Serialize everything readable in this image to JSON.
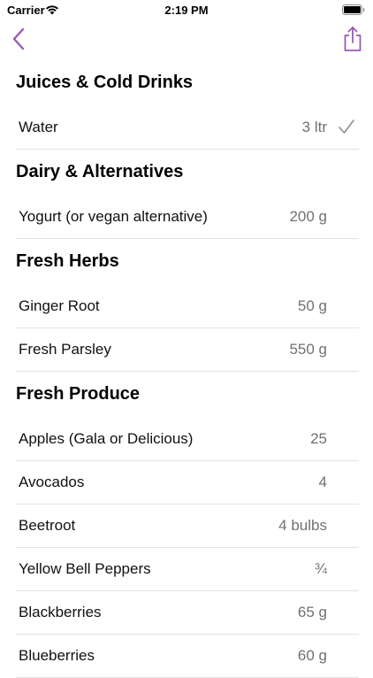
{
  "status_bar": {
    "carrier": "Carrier",
    "time": "2:19 PM"
  },
  "nav": {
    "back_icon": "chevron-left-icon",
    "share_icon": "share-icon",
    "accent_color": "#9b59b6"
  },
  "sections": [
    {
      "title": "Juices & Cold Drinks",
      "items": [
        {
          "name": "Water",
          "quantity": "3 ltr",
          "checked": true
        }
      ]
    },
    {
      "title": "Dairy & Alternatives",
      "items": [
        {
          "name": "Yogurt (or vegan alternative)",
          "quantity": "200 g",
          "checked": false
        }
      ]
    },
    {
      "title": "Fresh Herbs",
      "items": [
        {
          "name": "Ginger Root",
          "quantity": "50 g",
          "checked": false
        },
        {
          "name": "Fresh Parsley",
          "quantity": "550 g",
          "checked": false
        }
      ]
    },
    {
      "title": "Fresh Produce",
      "items": [
        {
          "name": "Apples (Gala or Delicious)",
          "quantity": "25",
          "checked": false
        },
        {
          "name": "Avocados",
          "quantity": "4",
          "checked": false
        },
        {
          "name": "Beetroot",
          "quantity": "4 bulbs",
          "checked": false
        },
        {
          "name": "Yellow Bell Peppers",
          "quantity": "¾",
          "checked": false
        },
        {
          "name": "Blackberries",
          "quantity": "65 g",
          "checked": false
        },
        {
          "name": "Blueberries",
          "quantity": "60 g",
          "checked": false
        }
      ]
    }
  ]
}
